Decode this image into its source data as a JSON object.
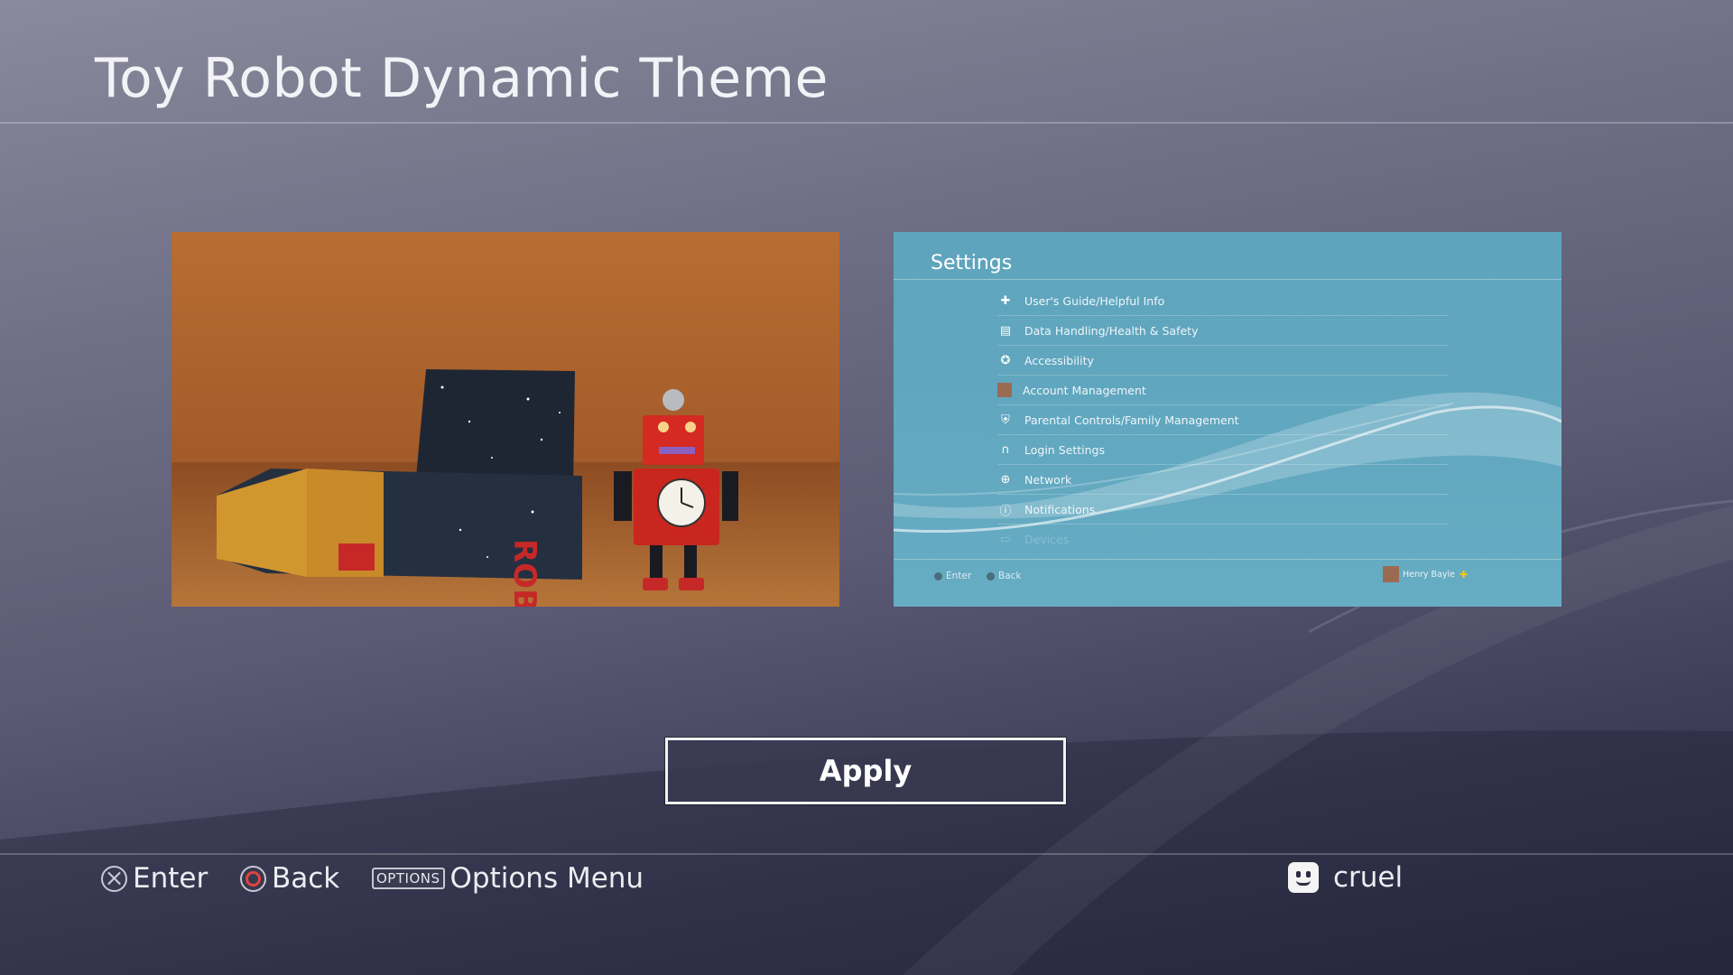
{
  "page": {
    "title": "Toy Robot Dynamic Theme"
  },
  "preview_settings": {
    "title": "Settings",
    "items": [
      {
        "label": "User's Guide/Helpful Info",
        "icon": "help-icon"
      },
      {
        "label": "Data Handling/Health & Safety",
        "icon": "document-icon"
      },
      {
        "label": "Accessibility",
        "icon": "accessibility-icon"
      },
      {
        "label": "Account Management",
        "icon": "avatar-icon"
      },
      {
        "label": "Parental Controls/Family Management",
        "icon": "shield-icon"
      },
      {
        "label": "Login Settings",
        "icon": "key-icon"
      },
      {
        "label": "Network",
        "icon": "globe-icon"
      },
      {
        "label": "Notifications",
        "icon": "info-icon"
      },
      {
        "label": "Devices",
        "icon": "device-icon"
      }
    ],
    "footer": {
      "enter": "Enter",
      "back": "Back",
      "user": "Henry Bayle"
    }
  },
  "apply_label": "Apply",
  "hints": {
    "enter": "Enter",
    "back": "Back",
    "options_key": "OPTIONS",
    "options": "Options Menu"
  },
  "user": {
    "name": "cruel"
  },
  "colors": {
    "accent_circle": "#e0443c",
    "preview_bg": "#61a7bf",
    "wood": "#a75d2b"
  }
}
